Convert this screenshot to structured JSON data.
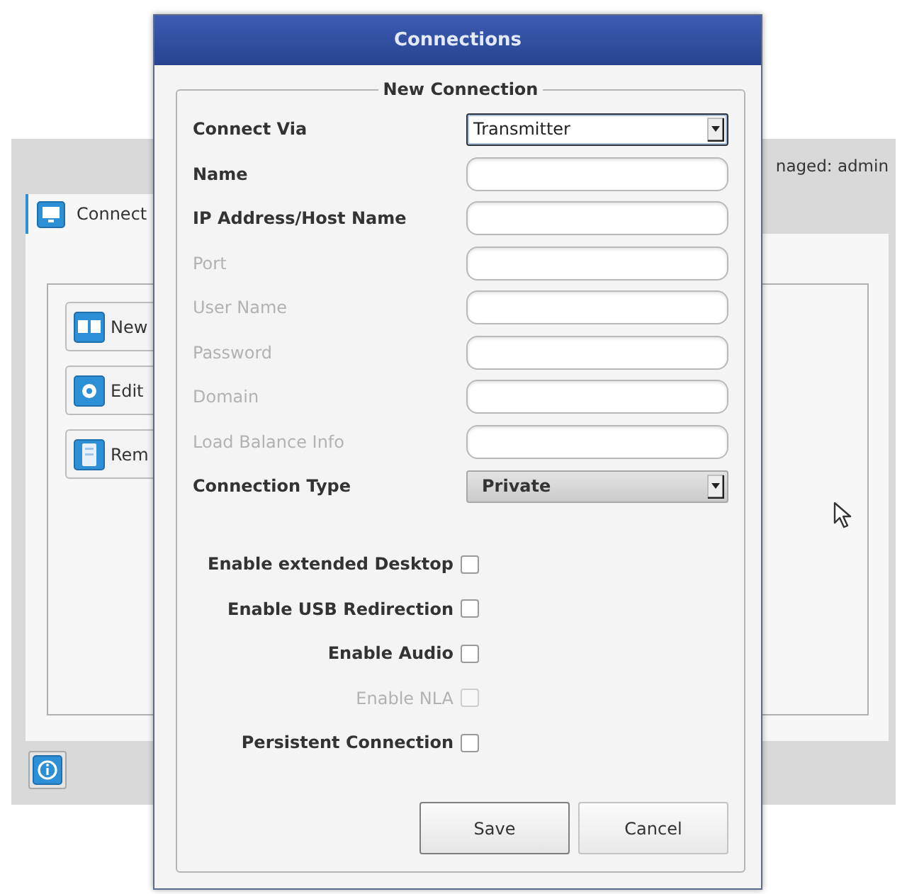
{
  "background_window": {
    "status_text": "naged: admin",
    "tabs": [
      {
        "label": "Connect",
        "selected": true
      }
    ],
    "buttons": [
      {
        "kind": "new",
        "label": "New"
      },
      {
        "kind": "edit",
        "label": "Edit"
      },
      {
        "kind": "remove",
        "label": "Rem"
      }
    ]
  },
  "dialog": {
    "title": "Connections",
    "group_title": "New Connection",
    "fields": [
      {
        "kind": "select",
        "label": "Connect Via",
        "value": "Transmitter",
        "focused": true,
        "disabled": false
      },
      {
        "kind": "text",
        "label": "Name",
        "disabled": false
      },
      {
        "kind": "text",
        "label": "IP Address/Host Name",
        "disabled": false
      },
      {
        "kind": "text",
        "label": "Port",
        "disabled": true
      },
      {
        "kind": "text",
        "label": "User Name",
        "disabled": true
      },
      {
        "kind": "text",
        "label": "Password",
        "disabled": true
      },
      {
        "kind": "text",
        "label": "Domain",
        "disabled": true
      },
      {
        "kind": "text",
        "label": "Load Balance Info",
        "disabled": true
      },
      {
        "kind": "select",
        "label": "Connection Type",
        "value": "Private",
        "focused": false,
        "disabled": false
      }
    ],
    "checkboxes": [
      {
        "label": "Enable extended Desktop",
        "checked": false,
        "disabled": false
      },
      {
        "label": "Enable USB Redirection",
        "checked": false,
        "disabled": false
      },
      {
        "label": "Enable Audio",
        "checked": false,
        "disabled": false
      },
      {
        "label": "Enable NLA",
        "checked": false,
        "disabled": true
      },
      {
        "label": "Persistent Connection",
        "checked": false,
        "disabled": false
      }
    ],
    "buttons": [
      {
        "label": "Save",
        "default": true
      },
      {
        "label": "Cancel",
        "default": false
      }
    ]
  }
}
